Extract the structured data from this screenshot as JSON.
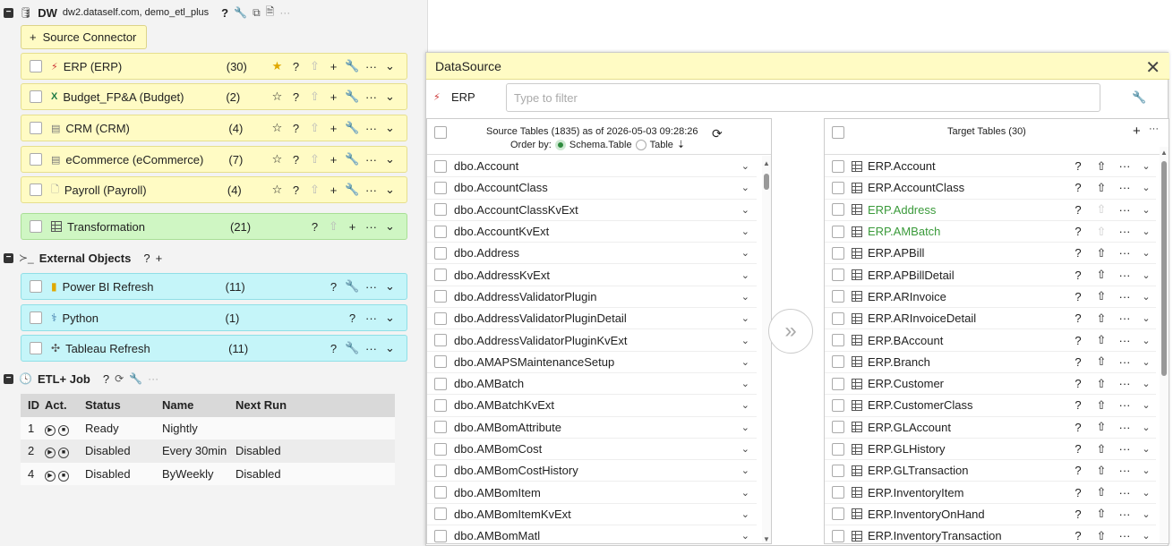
{
  "dw": {
    "title": "DW",
    "subtitle": "dw2.dataself.com, demo_etl_plus",
    "source_connector_label": "Source Connector"
  },
  "connectors": [
    {
      "label": "ERP (ERP)",
      "count": "(30)",
      "color": "yellow"
    },
    {
      "label": "Budget_FP&A (Budget)",
      "count": "(2)",
      "color": "yellow"
    },
    {
      "label": "CRM (CRM)",
      "count": "(4)",
      "color": "yellow"
    },
    {
      "label": "eCommerce (eCommerce)",
      "count": "(7)",
      "color": "yellow"
    },
    {
      "label": "Payroll (Payroll)",
      "count": "(4)",
      "color": "yellow"
    },
    {
      "label": "Transformation",
      "count": "(21)",
      "color": "green"
    }
  ],
  "external": {
    "title": "External Objects",
    "items": [
      {
        "label": "Power BI Refresh",
        "count": "(11)"
      },
      {
        "label": "Python",
        "count": "(1)"
      },
      {
        "label": "Tableau Refresh",
        "count": "(11)"
      }
    ]
  },
  "etl": {
    "title": "ETL+ Job",
    "columns": [
      "ID",
      "Act.",
      "Status",
      "Name",
      "Next Run"
    ],
    "rows": [
      {
        "id": "1",
        "status": "Ready",
        "name": "Nightly",
        "next": ""
      },
      {
        "id": "2",
        "status": "Disabled",
        "name": "Every 30min",
        "next": "Disabled"
      },
      {
        "id": "4",
        "status": "Disabled",
        "name": "ByWeekly",
        "next": "Disabled"
      }
    ]
  },
  "dialog": {
    "title": "DataSource",
    "source_name": "ERP",
    "filter_placeholder": "Type to filter",
    "source": {
      "title": "Source Tables (1835)",
      "asof": "as of 2026-05-03 09:28:26",
      "order_by": "Order by:",
      "opt1": "Schema.Table",
      "opt2": "Table",
      "items": [
        "dbo.Account",
        "dbo.AccountClass",
        "dbo.AccountClassKvExt",
        "dbo.AccountKvExt",
        "dbo.Address",
        "dbo.AddressKvExt",
        "dbo.AddressValidatorPlugin",
        "dbo.AddressValidatorPluginDetail",
        "dbo.AddressValidatorPluginKvExt",
        "dbo.AMAPSMaintenanceSetup",
        "dbo.AMBatch",
        "dbo.AMBatchKvExt",
        "dbo.AMBomAttribute",
        "dbo.AMBomCost",
        "dbo.AMBomCostHistory",
        "dbo.AMBomItem",
        "dbo.AMBomItemKvExt",
        "dbo.AMBomMatl"
      ]
    },
    "target": {
      "title": "Target Tables (30)",
      "items": [
        "ERP.Account",
        "ERP.AccountClass",
        "ERP.Address",
        "ERP.AMBatch",
        "ERP.APBill",
        "ERP.APBillDetail",
        "ERP.ARInvoice",
        "ERP.ARInvoiceDetail",
        "ERP.BAccount",
        "ERP.Branch",
        "ERP.Customer",
        "ERP.CustomerClass",
        "ERP.GLAccount",
        "ERP.GLHistory",
        "ERP.GLTransaction",
        "ERP.InventoryItem",
        "ERP.InventoryOnHand",
        "ERP.InventoryTransaction"
      ],
      "new_items": [
        "ERP.Address",
        "ERP.AMBatch"
      ]
    }
  },
  "colors": {
    "yellow": "#fffbc4",
    "green": "#cff6c3",
    "cyan": "#c5f5f9",
    "new_item": "#3a9a3a"
  }
}
